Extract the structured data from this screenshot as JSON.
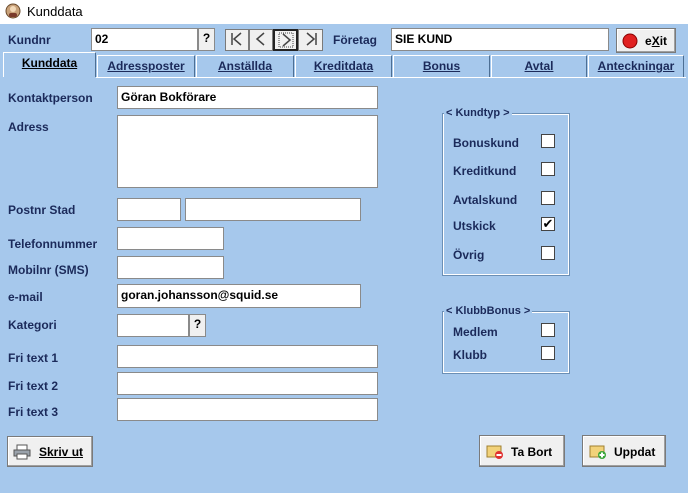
{
  "window": {
    "title": "Kunddata",
    "app_icon": "app-icon"
  },
  "header": {
    "kundnr_label": "Kundnr",
    "kundnr_value": "02",
    "kundnr_lookup": "?",
    "nav": [
      "first-record-icon",
      "previous-record-icon",
      "next-record-icon",
      "last-record-icon"
    ],
    "foretag_label": "Företag",
    "foretag_value": "SIE KUND",
    "exit_label_prefix": "e",
    "exit_label_accel": "X",
    "exit_label_suffix": "it",
    "exit_icon_color": "#e02020"
  },
  "tabs": [
    {
      "label": "Kunddata",
      "active": true
    },
    {
      "label": "Adressposter",
      "active": false
    },
    {
      "label": "Anställda",
      "active": false
    },
    {
      "label": "Kreditdata",
      "active": false
    },
    {
      "label": "Bonus",
      "active": false
    },
    {
      "label": "Avtal",
      "active": false
    },
    {
      "label": "Anteckningar",
      "active": false
    }
  ],
  "form": {
    "kontaktperson_label": "Kontaktperson",
    "kontaktperson_value": "Göran Bokförare",
    "adress_label": "Adress",
    "adress_value": "",
    "postnr_label": "Postnr Stad",
    "postnr_value": "",
    "stad_value": "",
    "telefon_label": "Telefonnummer",
    "telefon_value": "",
    "mobil_label": "Mobilnr (SMS)",
    "mobil_value": "",
    "email_label": "e-mail",
    "email_value": "goran.johansson@squid.se",
    "kategori_label": "Kategori",
    "kategori_value": "",
    "kategori_lookup": "?",
    "fritext1_label": "Fri text 1",
    "fritext1_value": "",
    "fritext2_label": "Fri text 2",
    "fritext2_value": "",
    "fritext3_label": "Fri text 3",
    "fritext3_value": ""
  },
  "kundtyp": {
    "title": "< Kundtyp >",
    "items": [
      {
        "label": "Bonuskund",
        "checked": false,
        "mark": ""
      },
      {
        "label": "Kreditkund",
        "checked": false,
        "mark": ""
      },
      {
        "label": "Avtalskund",
        "checked": false,
        "mark": ""
      },
      {
        "label": "Utskick",
        "checked": true,
        "mark": "✔"
      },
      {
        "label": "Övrig",
        "checked": false,
        "mark": ""
      }
    ]
  },
  "klubbbonus": {
    "title": "< KlubbBonus >",
    "items": [
      {
        "label": "Medlem",
        "checked": false,
        "mark": ""
      },
      {
        "label": "Klubb",
        "checked": false,
        "mark": ""
      }
    ]
  },
  "buttons": {
    "skriv_ut": "Skriv ut",
    "ta_bort": "Ta Bort",
    "uppdat": "Uppdat"
  }
}
